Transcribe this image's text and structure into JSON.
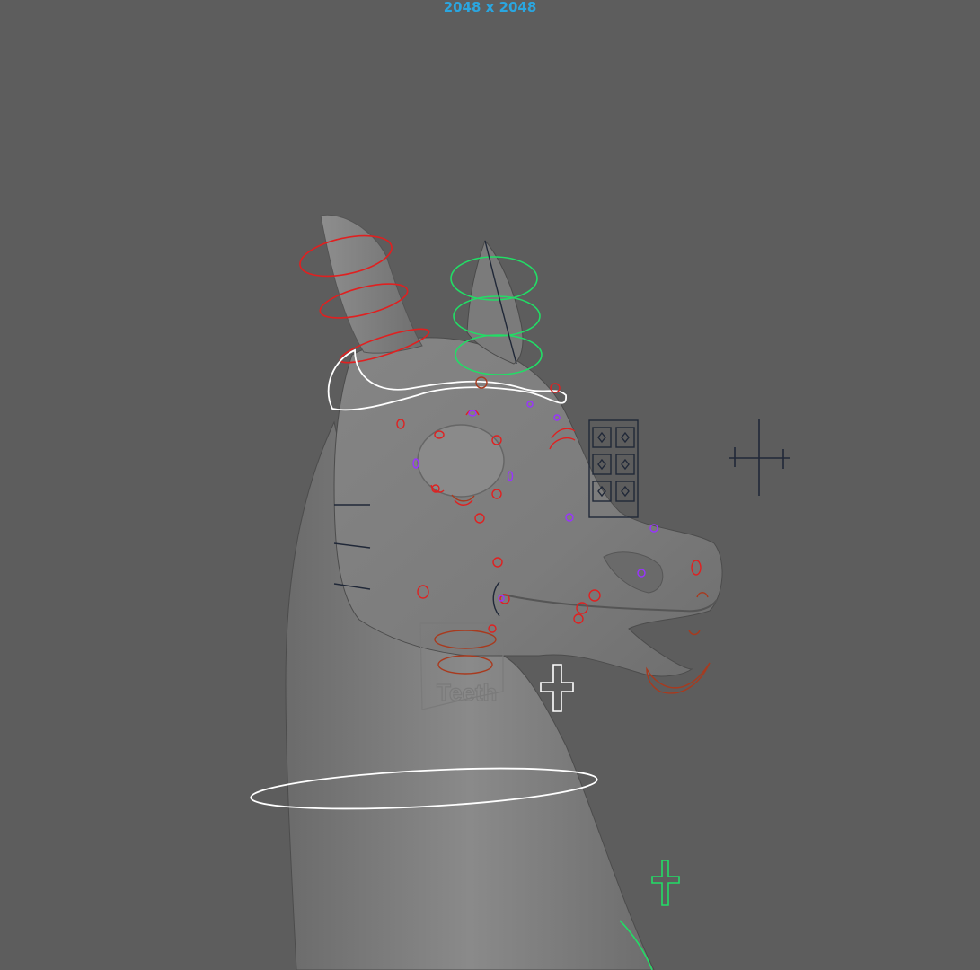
{
  "viewport": {
    "resolution_label": "2048 x 2048",
    "background_color": "#5d5d5d",
    "gate_label_color": "#2aa6e0"
  },
  "rig": {
    "teeth_label": "Teeth",
    "controls": [
      {
        "name": "left-ear-controls",
        "color": "#e02020"
      },
      {
        "name": "right-ear-controls",
        "color": "#22dd66"
      },
      {
        "name": "head-control",
        "color": "#ffffff"
      },
      {
        "name": "neck-control",
        "color": "#ffffff"
      },
      {
        "name": "face-controls",
        "color": "#e02020"
      },
      {
        "name": "face-secondary-controls",
        "color": "#9933ff"
      },
      {
        "name": "jaw-controls",
        "color": "#a83a1e"
      },
      {
        "name": "eye-target-controls",
        "color": "#202838"
      }
    ]
  }
}
